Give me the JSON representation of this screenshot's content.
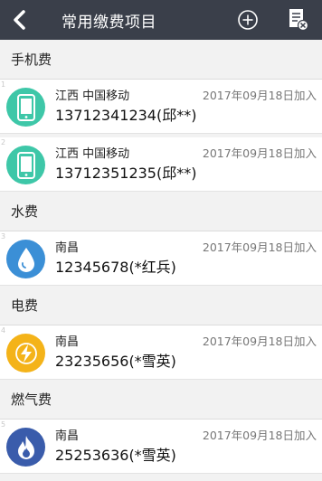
{
  "header": {
    "title": "常用缴费项目",
    "back_icon": "back-arrow-icon",
    "add_icon": "plus-circle-icon",
    "manage_icon": "bill-delete-icon"
  },
  "colors": {
    "header_bg": "#3a3f4a",
    "phone": "#3ec7a8",
    "water": "#3b8fd6",
    "electric": "#f4b319",
    "gas": "#3a5cab"
  },
  "sections": [
    {
      "title": "手机费",
      "items": [
        {
          "index": "1",
          "location": "江西 中国移动",
          "account": "13712341234(邱**)",
          "date": "2017年09月18日加入",
          "icon": "phone-icon"
        },
        {
          "index": "2",
          "location": "江西 中国移动",
          "account": "13712351235(邱**)",
          "date": "2017年09月18日加入",
          "icon": "phone-icon"
        }
      ]
    },
    {
      "title": "水费",
      "items": [
        {
          "index": "3",
          "location": "南昌",
          "account": "12345678(*红兵)",
          "date": "2017年09月18日加入",
          "icon": "water-drop-icon"
        }
      ]
    },
    {
      "title": "电费",
      "items": [
        {
          "index": "4",
          "location": "南昌",
          "account": "23235656(*雪英)",
          "date": "2017年09月18日加入",
          "icon": "lightning-icon"
        }
      ]
    },
    {
      "title": "燃气费",
      "items": [
        {
          "index": "5",
          "location": "南昌",
          "account": "25253636(*雪英)",
          "date": "2017年09月18日加入",
          "icon": "flame-icon"
        }
      ]
    }
  ]
}
